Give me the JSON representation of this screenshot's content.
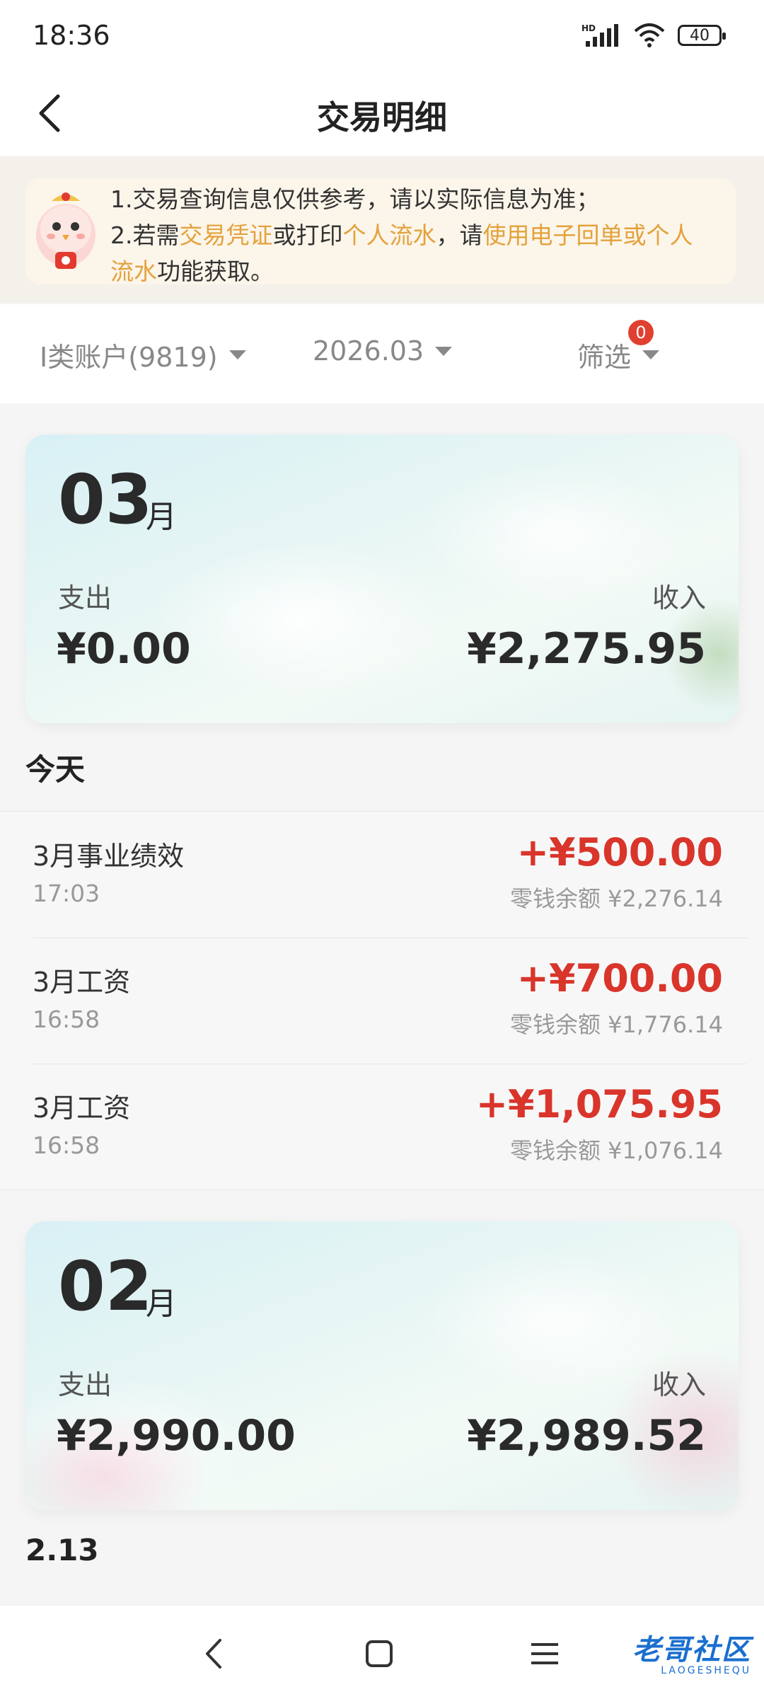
{
  "status_bar": {
    "time": "18:36",
    "battery": "40",
    "network": "HD"
  },
  "header": {
    "title": "交易明细",
    "back_icon": "chevron-left-icon"
  },
  "notice": {
    "line1": "1.交易查询信息仅供参考，请以实际信息为准；",
    "line2_prefix": "2.若需",
    "line2_link1": "交易凭证",
    "line2_mid": "或打印",
    "line2_link2": "个人流水",
    "line2_mid2": "，请",
    "line2_link3a": "使用电子回单或个人",
    "line3_link3b": "流水",
    "line3_suffix": "功能获取。",
    "highlight_color": "#e3a23c"
  },
  "filters": {
    "account": "I类账户(9819)",
    "month": "2026.03",
    "filter": "筛选",
    "filter_badge": "0"
  },
  "months": [
    {
      "month": "03",
      "unit": "月",
      "expense_label": "支出",
      "income_label": "收入",
      "expense": "¥0.00",
      "income": "¥2,275.95"
    },
    {
      "month": "02",
      "unit": "月",
      "expense_label": "支出",
      "income_label": "收入",
      "expense": "¥2,990.00",
      "income": "¥2,989.52"
    }
  ],
  "groups": [
    {
      "label": "今天"
    },
    {
      "label": "2.13"
    }
  ],
  "transactions": [
    {
      "name": "3月事业绩效",
      "time": "17:03",
      "amount": "+¥500.00",
      "balance": "零钱余额 ¥2,276.14"
    },
    {
      "name": "3月工资",
      "time": "16:58",
      "amount": "+¥700.00",
      "balance": "零钱余额 ¥1,776.14"
    },
    {
      "name": "3月工资",
      "time": "16:58",
      "amount": "+¥1,075.95",
      "balance": "零钱余额 ¥1,076.14"
    }
  ],
  "nav": {
    "back": "back-icon",
    "home": "home-icon",
    "menu": "menu-icon"
  },
  "watermark": {
    "main": "老哥社区",
    "sub": "LAOGESHEQU"
  },
  "colors": {
    "accent_red": "#d9352b",
    "highlight": "#e3a23c"
  }
}
